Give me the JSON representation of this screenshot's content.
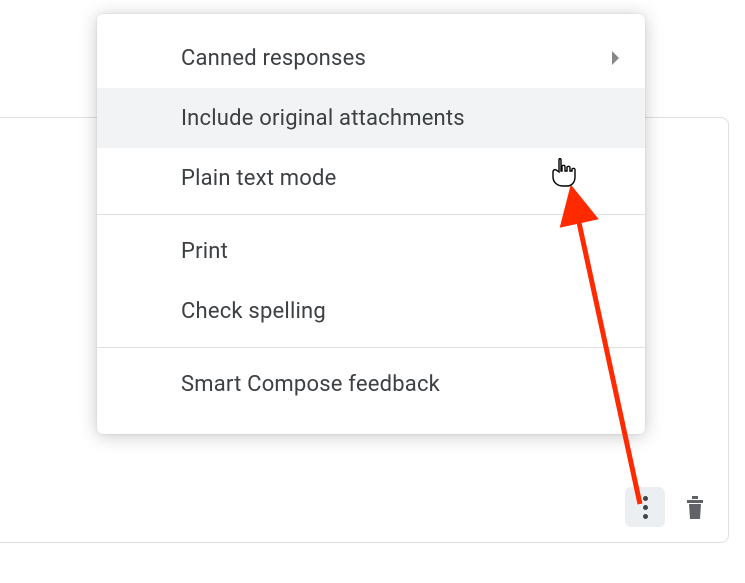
{
  "menu": {
    "sections": [
      {
        "items": [
          {
            "label": "Canned responses",
            "has_submenu": true,
            "hovered": false
          },
          {
            "label": "Include original attachments",
            "has_submenu": false,
            "hovered": true
          },
          {
            "label": "Plain text mode",
            "has_submenu": false,
            "hovered": false
          }
        ]
      },
      {
        "items": [
          {
            "label": "Print",
            "has_submenu": false,
            "hovered": false
          },
          {
            "label": "Check spelling",
            "has_submenu": false,
            "hovered": false
          }
        ]
      },
      {
        "items": [
          {
            "label": "Smart Compose feedback",
            "has_submenu": false,
            "hovered": false
          }
        ]
      }
    ]
  },
  "annotation": {
    "arrow_color": "#ff2a00"
  }
}
